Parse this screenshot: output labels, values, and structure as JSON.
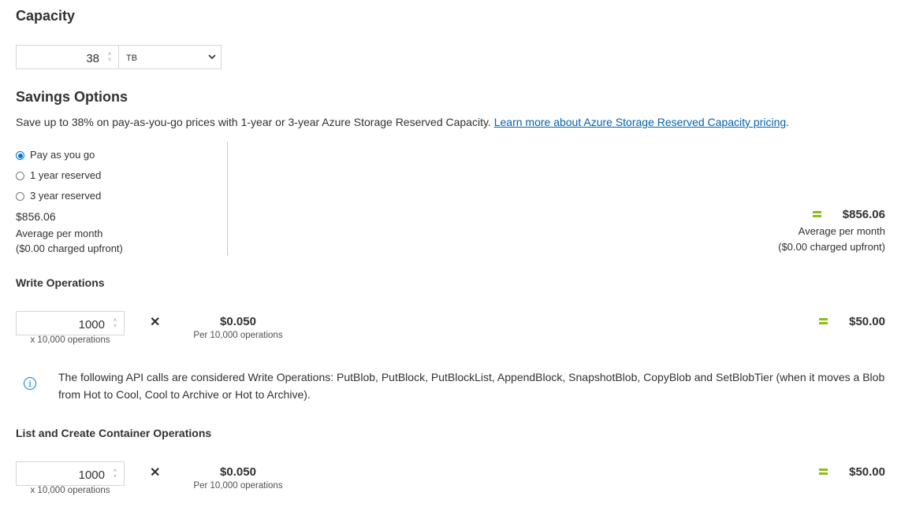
{
  "capacity": {
    "title": "Capacity",
    "value": "38",
    "unit": "TB",
    "spinner_up": "˄",
    "spinner_down": "˅"
  },
  "savings": {
    "title": "Savings Options",
    "description": "Save up to 38% on pay-as-you-go prices with 1-year or 3-year Azure Storage Reserved Capacity.",
    "link": "Learn more about Azure Storage Reserved Capacity pricing",
    "link_suffix": ".",
    "options": [
      {
        "label": "Pay as you go",
        "selected": true
      },
      {
        "label": "1 year reserved",
        "selected": false
      },
      {
        "label": "3 year reserved",
        "selected": false
      }
    ],
    "left_price": "$856.06",
    "left_period": "Average per month",
    "left_upfront": "($0.00 charged upfront)",
    "right_price": "$856.06",
    "right_period": "Average per month",
    "right_upfront": "($0.00 charged upfront)"
  },
  "write_ops": {
    "title": "Write Operations",
    "quantity": "1000",
    "quantity_unit": "x 10,000 operations",
    "times": "✕",
    "unit_price": "$0.050",
    "unit_price_label": "Per 10,000 operations",
    "total": "$50.00",
    "info_icon": "i",
    "info_line1": "The following API calls are considered Write Operations: PutBlob, PutBlock, PutBlockList, AppendBlock, SnapshotBlob, CopyBlob and SetBlobTier (when it moves a Blob",
    "info_line2": "from Hot to Cool, Cool to Archive or Hot to Archive)."
  },
  "list_ops": {
    "title": "List and Create Container Operations",
    "quantity": "1000",
    "quantity_unit": "x 10,000 operations",
    "times": "✕",
    "unit_price": "$0.050",
    "unit_price_label": "Per 10,000 operations",
    "total": "$50.00"
  },
  "colors": {
    "accent": "#0078d4",
    "link": "#0063b1",
    "equals": "#8cbd18"
  }
}
